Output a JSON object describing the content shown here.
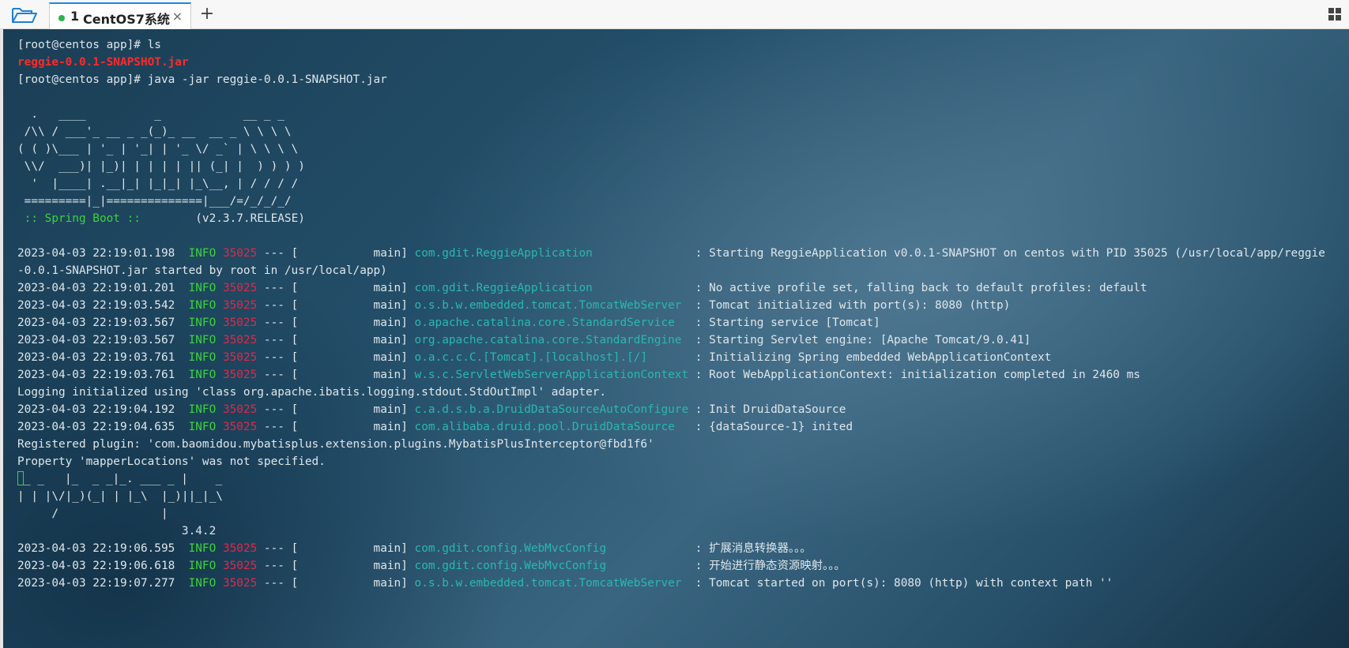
{
  "tabbar": {
    "tab": {
      "index": "1",
      "title": "CentOS7系统",
      "close": "×",
      "status_color": "#2cb34a"
    },
    "new_tab": "+"
  },
  "terminal": {
    "colors": {
      "red": "#ff2a2a",
      "green": "#3ad43a",
      "pid": "#e0284a",
      "logger": "#29b8b0",
      "text": "#dfe6ea"
    },
    "lines": [
      [
        {
          "t": "[root@centos app]# ls"
        }
      ],
      [
        {
          "t": "reggie-0.0.1-SNAPSHOT.jar",
          "c": "red"
        }
      ],
      [
        {
          "t": "[root@centos app]# java -jar reggie-0.0.1-SNAPSHOT.jar"
        }
      ],
      [
        {
          "t": ""
        }
      ],
      [
        {
          "t": "  .   ____          _            __ _ _"
        }
      ],
      [
        {
          "t": " /\\\\ / ___'_ __ _ _(_)_ __  __ _ \\ \\ \\ \\"
        }
      ],
      [
        {
          "t": "( ( )\\___ | '_ | '_| | '_ \\/ _` | \\ \\ \\ \\"
        }
      ],
      [
        {
          "t": " \\\\/  ___)| |_)| | | | | || (_| |  ) ) ) )"
        }
      ],
      [
        {
          "t": "  '  |____| .__|_| |_|_| |_\\__, | / / / /"
        }
      ],
      [
        {
          "t": " =========|_|==============|___/=/_/_/_/"
        }
      ],
      [
        {
          "t": " :: Spring Boot :: ",
          "c": "grn"
        },
        {
          "t": "       (v2.3.7.RELEASE)"
        }
      ],
      [
        {
          "t": ""
        }
      ],
      [
        {
          "t": "2023-04-03 22:19:01.198  "
        },
        {
          "t": "INFO",
          "c": "grn"
        },
        {
          "t": " "
        },
        {
          "t": "35025",
          "c": "pid"
        },
        {
          "t": " --- [           main] "
        },
        {
          "t": "com.gdit.ReggieApplication              ",
          "c": "logger"
        },
        {
          "t": " : Starting ReggieApplication v0.0.1-SNAPSHOT on centos with PID 35025 (/usr/local/app/reggie"
        }
      ],
      [
        {
          "t": "-0.0.1-SNAPSHOT.jar started by root in /usr/local/app)"
        }
      ],
      [
        {
          "t": "2023-04-03 22:19:01.201  "
        },
        {
          "t": "INFO",
          "c": "grn"
        },
        {
          "t": " "
        },
        {
          "t": "35025",
          "c": "pid"
        },
        {
          "t": " --- [           main] "
        },
        {
          "t": "com.gdit.ReggieApplication              ",
          "c": "logger"
        },
        {
          "t": " : No active profile set, falling back to default profiles: default"
        }
      ],
      [
        {
          "t": "2023-04-03 22:19:03.542  "
        },
        {
          "t": "INFO",
          "c": "grn"
        },
        {
          "t": " "
        },
        {
          "t": "35025",
          "c": "pid"
        },
        {
          "t": " --- [           main] "
        },
        {
          "t": "o.s.b.w.embedded.tomcat.TomcatWebServer ",
          "c": "logger"
        },
        {
          "t": " : Tomcat initialized with port(s): 8080 (http)"
        }
      ],
      [
        {
          "t": "2023-04-03 22:19:03.567  "
        },
        {
          "t": "INFO",
          "c": "grn"
        },
        {
          "t": " "
        },
        {
          "t": "35025",
          "c": "pid"
        },
        {
          "t": " --- [           main] "
        },
        {
          "t": "o.apache.catalina.core.StandardService  ",
          "c": "logger"
        },
        {
          "t": " : Starting service [Tomcat]"
        }
      ],
      [
        {
          "t": "2023-04-03 22:19:03.567  "
        },
        {
          "t": "INFO",
          "c": "grn"
        },
        {
          "t": " "
        },
        {
          "t": "35025",
          "c": "pid"
        },
        {
          "t": " --- [           main] "
        },
        {
          "t": "org.apache.catalina.core.StandardEngine ",
          "c": "logger"
        },
        {
          "t": " : Starting Servlet engine: [Apache Tomcat/9.0.41]"
        }
      ],
      [
        {
          "t": "2023-04-03 22:19:03.761  "
        },
        {
          "t": "INFO",
          "c": "grn"
        },
        {
          "t": " "
        },
        {
          "t": "35025",
          "c": "pid"
        },
        {
          "t": " --- [           main] "
        },
        {
          "t": "o.a.c.c.C.[Tomcat].[localhost].[/]      ",
          "c": "logger"
        },
        {
          "t": " : Initializing Spring embedded WebApplicationContext"
        }
      ],
      [
        {
          "t": "2023-04-03 22:19:03.761  "
        },
        {
          "t": "INFO",
          "c": "grn"
        },
        {
          "t": " "
        },
        {
          "t": "35025",
          "c": "pid"
        },
        {
          "t": " --- [           main] "
        },
        {
          "t": "w.s.c.ServletWebServerApplicationContext",
          "c": "logger"
        },
        {
          "t": " : Root WebApplicationContext: initialization completed in 2460 ms"
        }
      ],
      [
        {
          "t": "Logging initialized using 'class org.apache.ibatis.logging.stdout.StdOutImpl' adapter."
        }
      ],
      [
        {
          "t": "2023-04-03 22:19:04.192  "
        },
        {
          "t": "INFO",
          "c": "grn"
        },
        {
          "t": " "
        },
        {
          "t": "35025",
          "c": "pid"
        },
        {
          "t": " --- [           main] "
        },
        {
          "t": "c.a.d.s.b.a.DruidDataSourceAutoConfigure",
          "c": "logger"
        },
        {
          "t": " : Init DruidDataSource"
        }
      ],
      [
        {
          "t": "2023-04-03 22:19:04.635  "
        },
        {
          "t": "INFO",
          "c": "grn"
        },
        {
          "t": " "
        },
        {
          "t": "35025",
          "c": "pid"
        },
        {
          "t": " --- [           main] "
        },
        {
          "t": "com.alibaba.druid.pool.DruidDataSource  ",
          "c": "logger"
        },
        {
          "t": " : {dataSource-1} inited"
        }
      ],
      [
        {
          "t": "Registered plugin: 'com.baomidou.mybatisplus.extension.plugins.MybatisPlusInterceptor@fbd1f6'"
        }
      ],
      [
        {
          "t": "Property 'mapperLocations' was not specified."
        }
      ],
      [
        {
          "t": "",
          "cursor": true
        },
        {
          "t": "_ _   |_  _ _|_. ___ _ |    _"
        }
      ],
      [
        {
          "t": "| | |\\/|_)(_| | |_\\  |_)||_|_\\"
        }
      ],
      [
        {
          "t": "     /               |"
        }
      ],
      [
        {
          "t": "                        3.4.2"
        }
      ],
      [
        {
          "t": "2023-04-03 22:19:06.595  "
        },
        {
          "t": "INFO",
          "c": "grn"
        },
        {
          "t": " "
        },
        {
          "t": "35025",
          "c": "pid"
        },
        {
          "t": " --- [           main] "
        },
        {
          "t": "com.gdit.config.WebMvcConfig            ",
          "c": "logger"
        },
        {
          "t": " : 扩展消息转换器。。。"
        }
      ],
      [
        {
          "t": "2023-04-03 22:19:06.618  "
        },
        {
          "t": "INFO",
          "c": "grn"
        },
        {
          "t": " "
        },
        {
          "t": "35025",
          "c": "pid"
        },
        {
          "t": " --- [           main] "
        },
        {
          "t": "com.gdit.config.WebMvcConfig            ",
          "c": "logger"
        },
        {
          "t": " : 开始进行静态资源映射。。。"
        }
      ],
      [
        {
          "t": "2023-04-03 22:19:07.277  "
        },
        {
          "t": "INFO",
          "c": "grn"
        },
        {
          "t": " "
        },
        {
          "t": "35025",
          "c": "pid"
        },
        {
          "t": " --- [           main] "
        },
        {
          "t": "o.s.b.w.embedded.tomcat.TomcatWebServer ",
          "c": "logger"
        },
        {
          "t": " : Tomcat started on port(s): 8080 (http) with context path ''"
        }
      ]
    ]
  }
}
